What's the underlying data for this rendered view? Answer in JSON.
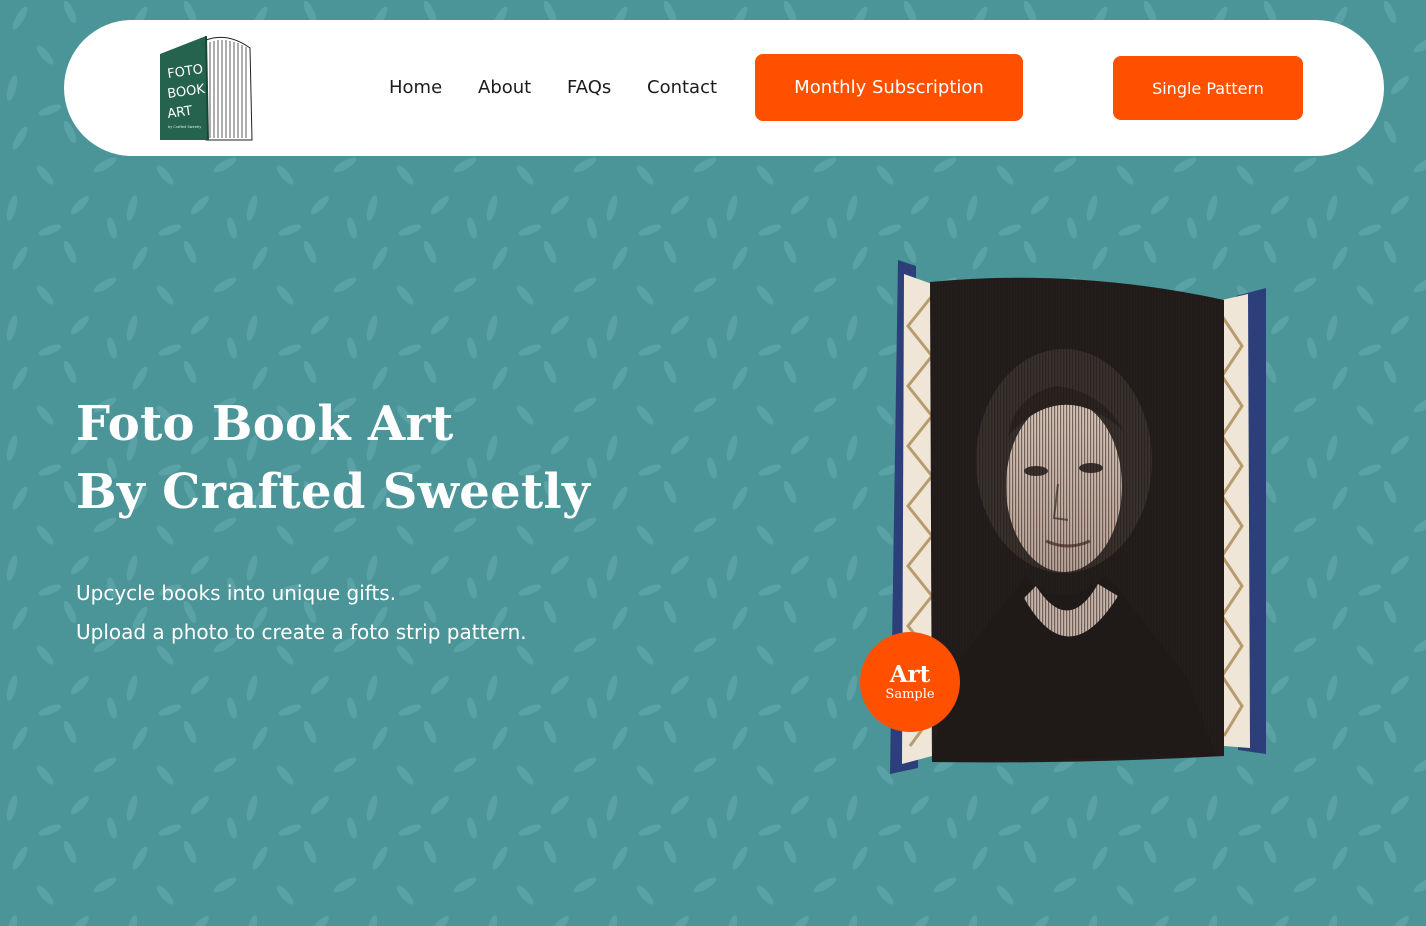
{
  "brand": {
    "logo_text": [
      "FOTO",
      "BOOK",
      "ART"
    ],
    "logo_tagline": "by Crafted Sweetly",
    "colors": {
      "background": "#4b9598",
      "accent": "#ff5000",
      "header": "#ffffff",
      "logo_green": "#25634f"
    }
  },
  "nav": {
    "items": [
      {
        "label": "Home"
      },
      {
        "label": "About"
      },
      {
        "label": "FAQs"
      },
      {
        "label": "Contact"
      }
    ],
    "cta_monthly": "Monthly Subscription",
    "cta_single": "Single Pattern"
  },
  "hero": {
    "title_line1": "Foto Book Art",
    "title_line2": "By Crafted Sweetly",
    "subtitle_line1": "Upcycle books into unique gifts.",
    "subtitle_line2": "Upload a photo to create a foto strip pattern."
  },
  "badge": {
    "title": "Art",
    "subtitle": "Sample"
  }
}
